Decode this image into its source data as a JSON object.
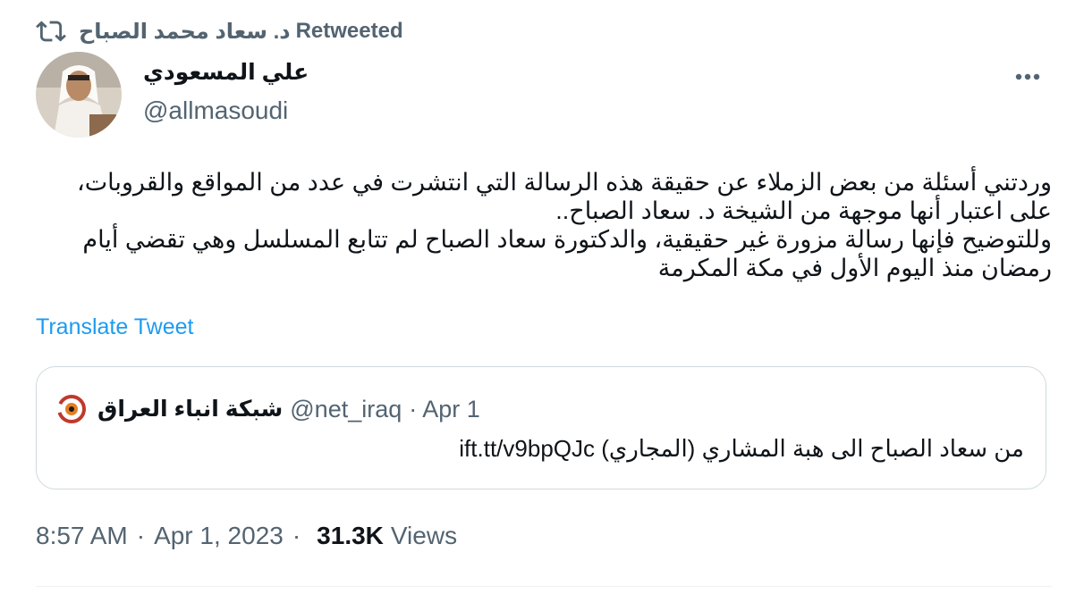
{
  "retweet": {
    "icon": "retweet-icon",
    "retweeter": "د. سعاد محمد الصباح",
    "label": "Retweeted"
  },
  "author": {
    "name": "علي المسعودي",
    "handle": "@allmasoudi",
    "avatar_icon": "profile-photo"
  },
  "more_icon": "more-dots-icon",
  "tweet": {
    "text": "وردتني أسئلة من بعض الزملاء عن حقيقة هذه الرسالة التي انتشرت في عدد من المواقع والقروبات، على اعتبار أنها موجهة من الشيخة د. سعاد الصباح..\nوللتوضيح فإنها رسالة مزورة غير حقيقية، والدكتورة سعاد الصباح لم تتابع المسلسل وهي تقضي أيام رمضان منذ اليوم الأول في مكة المكرمة"
  },
  "translate_label": "Translate Tweet",
  "quote": {
    "name": "شبكة انباء العراق",
    "handle": "@net_iraq",
    "date": "· Apr 1",
    "text": "من سعاد الصباح الى هبة المشاري (المجاري) ift.tt/v9bpQJc"
  },
  "meta": {
    "time": "8:57 AM",
    "sep1": "·",
    "date": "Apr 1, 2023",
    "sep2": "·",
    "views_count": "31.3K",
    "views_label": "Views"
  },
  "colors": {
    "text": "#0f1419",
    "secondary": "#536471",
    "link": "#1d9bf0",
    "border": "#cfd9de"
  }
}
